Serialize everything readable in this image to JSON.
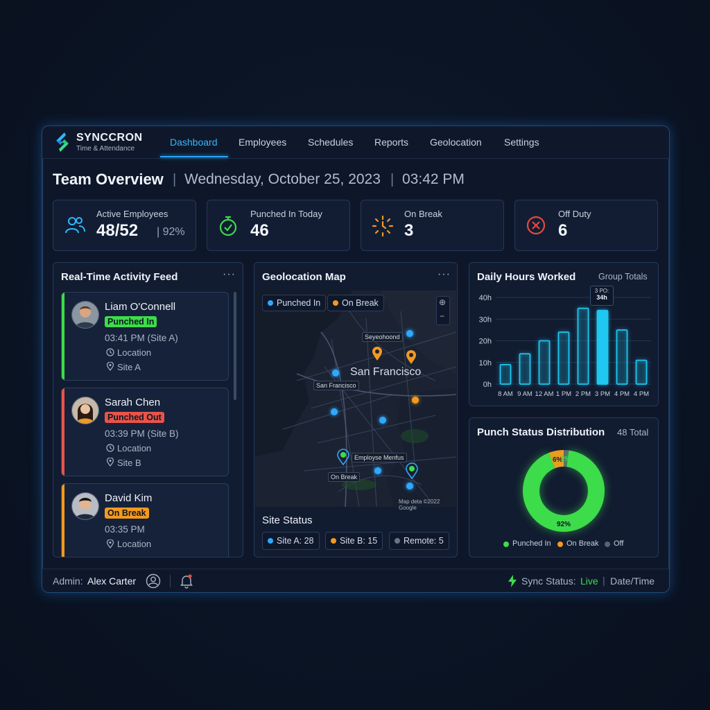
{
  "app": {
    "name": "SYNCCRON",
    "subtitle": "Time & Attendance"
  },
  "nav": {
    "tabs": [
      {
        "label": "Dashboard",
        "active": true
      },
      {
        "label": "Employees"
      },
      {
        "label": "Schedules"
      },
      {
        "label": "Reports"
      },
      {
        "label": "Geolocation"
      },
      {
        "label": "Settings"
      }
    ]
  },
  "header": {
    "title": "Team Overview",
    "separator": "|",
    "date": "Wednesday, October 25, 2023",
    "time": "03:42 PM"
  },
  "stats": [
    {
      "label": "Active Employees",
      "value": "48/52",
      "extra": "| 92%",
      "icon": "users-icon",
      "color": "#2fb8ff"
    },
    {
      "label": "Punched In Today",
      "value": "46",
      "icon": "stopwatch-icon",
      "color": "#3ddc4a"
    },
    {
      "label": "On Break",
      "value": "3",
      "icon": "break-clock-icon",
      "color": "#f39a1e"
    },
    {
      "label": "Off Duty",
      "value": "6",
      "icon": "x-circle-icon",
      "color": "#e8493f"
    }
  ],
  "activity": {
    "title": "Real-Time Activity Feed",
    "more": "···",
    "items": [
      {
        "name": "Liam O'Connell",
        "status": "Punched In",
        "status_color": "#3ddc4a",
        "time": "03:41 PM (Site A)",
        "location": "Location",
        "site": "Site A"
      },
      {
        "name": "Sarah Chen",
        "status": "Punched Out",
        "status_color": "#e8544a",
        "time": "03:39 PM (Site B)",
        "location": "Location",
        "site": "Site B"
      },
      {
        "name": "David Kim",
        "status": "On Break",
        "status_color": "#f39a1e",
        "time": "03:35 PM",
        "location": "Location"
      }
    ]
  },
  "map": {
    "title": "Geolocation Map",
    "more": "···",
    "legend": [
      {
        "label": "Punched In",
        "color": "#2fa8ff"
      },
      {
        "label": "On Break",
        "color": "#f39a1e"
      }
    ],
    "city": "San Francisco",
    "labels": [
      "Seyeohoond",
      "San Francisco",
      "Employse Menfus",
      "On Break"
    ],
    "attribution": "Map deta ©2022 Google",
    "site_status_title": "Site Status",
    "sites": [
      {
        "label": "Site A: 28",
        "color": "#2fa8ff"
      },
      {
        "label": "Site B: 15",
        "color": "#f39a1e"
      },
      {
        "label": "Remote: 5",
        "color": "#6b7485"
      }
    ]
  },
  "hours": {
    "title": "Daily Hours Worked",
    "subtitle": "Group Totals",
    "tooltip": {
      "line1": "3 PO:",
      "line2": "34h"
    }
  },
  "chart_data": [
    {
      "type": "bar",
      "title": "Daily Hours Worked",
      "categories": [
        "8 AM",
        "9 AM",
        "12 AM",
        "1 PM",
        "2 PM",
        "3 PM",
        "4 PM",
        "4 PM"
      ],
      "values": [
        9,
        14,
        20,
        24,
        35,
        34,
        25,
        11
      ],
      "highlight_index": 5,
      "yticks": [
        "0h",
        "10h",
        "20h",
        "30h",
        "40h"
      ],
      "ylim": [
        0,
        40
      ],
      "grid": true
    },
    {
      "type": "pie",
      "title": "Punch Status Distribution",
      "total_label": "48 Total",
      "labels": [
        "Punched In",
        "On Break",
        "Off"
      ],
      "values": [
        92,
        6,
        2
      ],
      "value_labels": [
        "92%",
        "6%",
        "2%"
      ],
      "colors": [
        "#3ddc4a",
        "#f39a1e",
        "#5b6270"
      ]
    }
  ],
  "footer": {
    "admin_label": "Admin:",
    "admin_name": "Alex Carter",
    "sync_label": "Sync Status:",
    "sync_value": "Live",
    "sep": "|",
    "datetime": "Date/Time"
  }
}
